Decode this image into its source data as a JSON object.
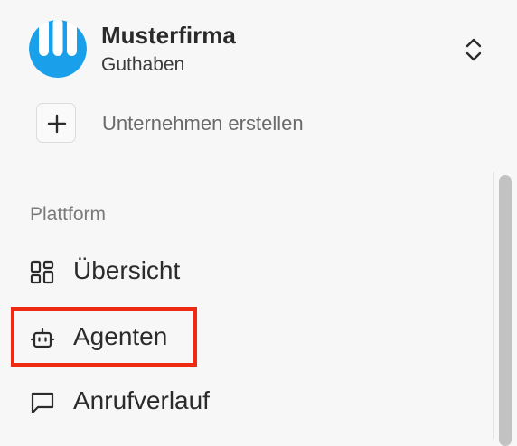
{
  "organization": {
    "name": "Musterfirma",
    "subtitle": "Guthaben",
    "logo_colors": {
      "primary": "#1aa0ea",
      "background": "#ffffff"
    }
  },
  "create_company": {
    "label": "Unternehmen erstellen"
  },
  "section": {
    "label": "Plattform"
  },
  "nav": {
    "items": [
      {
        "label": "Übersicht",
        "icon": "dashboard-icon"
      },
      {
        "label": "Agenten",
        "icon": "bot-icon"
      },
      {
        "label": "Anrufverlauf",
        "icon": "message-icon"
      }
    ]
  },
  "highlight_color": "#ee2a12"
}
